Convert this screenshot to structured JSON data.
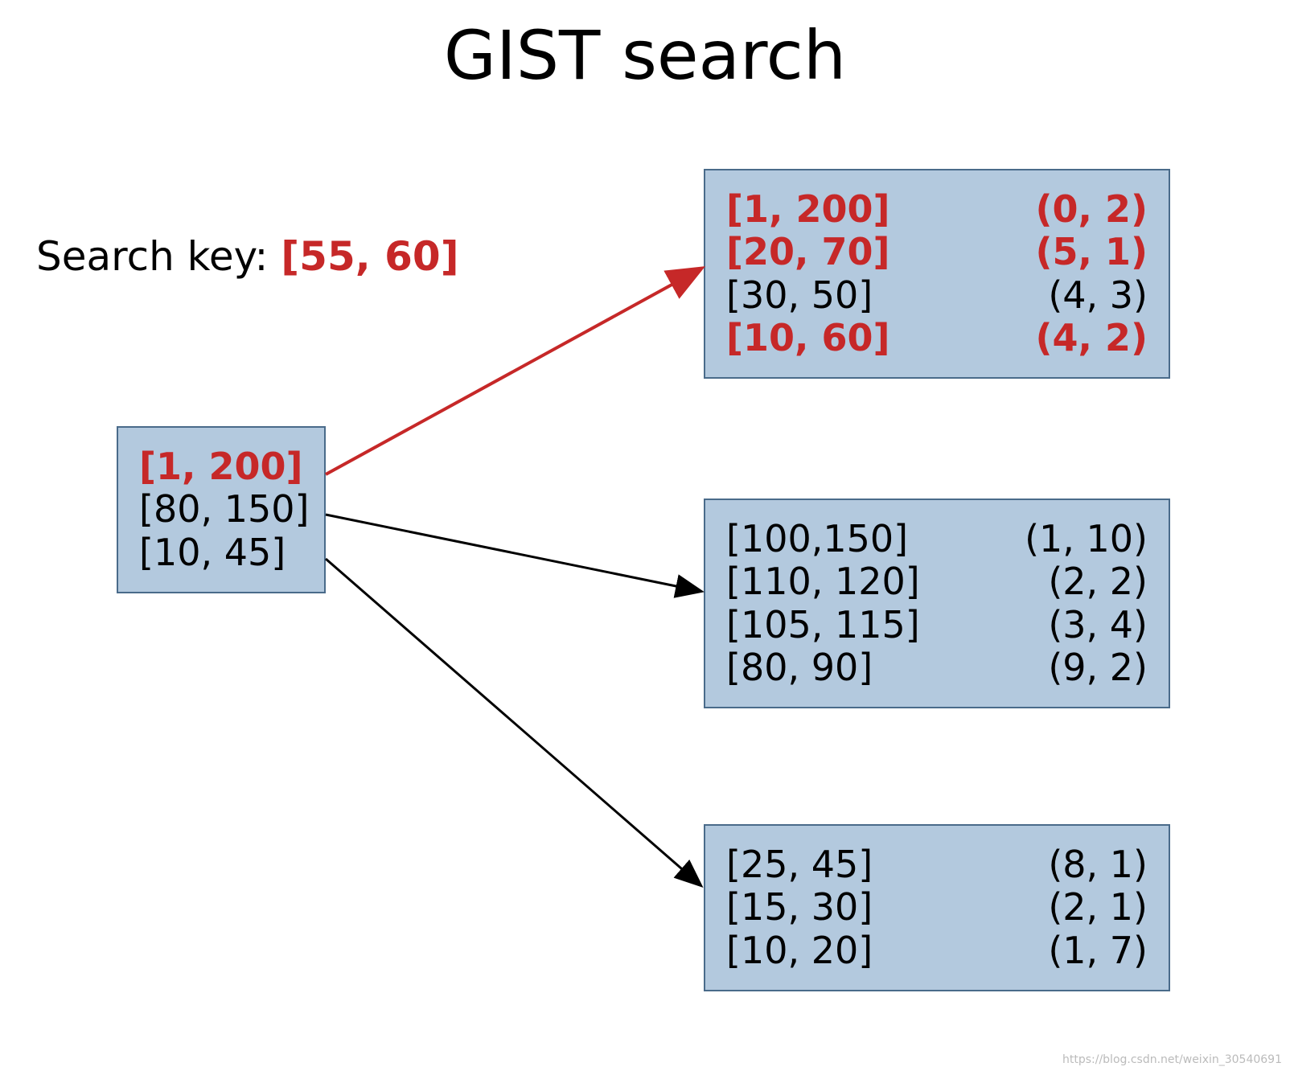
{
  "title": "GIST search",
  "search_key_label": "Search key: ",
  "search_key_value": "[55, 60]",
  "colors": {
    "highlight": "#c62828",
    "node_fill": "#b3c9de",
    "node_border": "#4a6b8a"
  },
  "root": {
    "entries": [
      {
        "range": "[1, 200]",
        "highlight": true
      },
      {
        "range": "[80, 150]",
        "highlight": false
      },
      {
        "range": "[10, 45]",
        "highlight": false
      }
    ]
  },
  "leaves": [
    {
      "highlight_arrow": true,
      "rows": [
        {
          "range": "[1, 200]",
          "tid": "(0, 2)",
          "highlight": true
        },
        {
          "range": "[20, 70]",
          "tid": "(5, 1)",
          "highlight": true
        },
        {
          "range": "[30, 50]",
          "tid": "(4, 3)",
          "highlight": false
        },
        {
          "range": "[10, 60]",
          "tid": "(4, 2)",
          "highlight": true
        }
      ]
    },
    {
      "highlight_arrow": false,
      "rows": [
        {
          "range": "[100,150]",
          "tid": "(1, 10)",
          "highlight": false
        },
        {
          "range": "[110, 120]",
          "tid": "(2, 2)",
          "highlight": false
        },
        {
          "range": "[105, 115]",
          "tid": "(3, 4)",
          "highlight": false
        },
        {
          "range": "[80, 90]",
          "tid": "(9, 2)",
          "highlight": false
        }
      ]
    },
    {
      "highlight_arrow": false,
      "rows": [
        {
          "range": "[25, 45]",
          "tid": "(8, 1)",
          "highlight": false
        },
        {
          "range": "[15, 30]",
          "tid": "(2, 1)",
          "highlight": false
        },
        {
          "range": "[10, 20]",
          "tid": "(1, 7)",
          "highlight": false
        }
      ]
    }
  ],
  "watermark": "https://blog.csdn.net/weixin_30540691"
}
